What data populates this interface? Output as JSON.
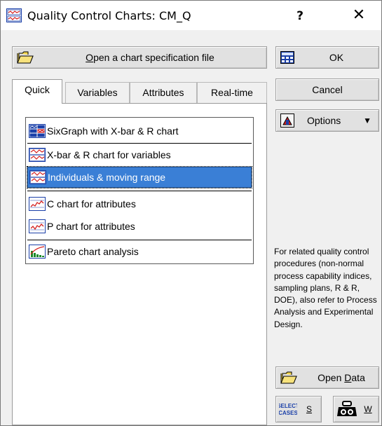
{
  "window": {
    "title": "Quality Control Charts: CM_Q",
    "help_glyph": "?",
    "close_glyph": "✕"
  },
  "buttons": {
    "open_spec": {
      "prefix": "",
      "accel": "O",
      "rest": "pen a chart specification file",
      "icon": "open-folder-icon"
    },
    "ok": {
      "label": "OK",
      "icon": "ok-calculator-icon"
    },
    "cancel": {
      "label": "Cancel"
    },
    "options": {
      "label": "Options",
      "arrow": "▼",
      "icon": "options-icon"
    },
    "open_data": {
      "prefix": "Open ",
      "accel": "D",
      "rest": "ata",
      "icon": "open-folder-icon"
    },
    "select_cases": {
      "icon_text_top": "SELECT",
      "icon_text_bottom": "CASES",
      "accel": "S"
    },
    "weight": {
      "accel": "W",
      "icon": "weight-icon"
    }
  },
  "tabs": [
    {
      "label": "Quick",
      "active": true
    },
    {
      "label": "Variables",
      "active": false
    },
    {
      "label": "Attributes",
      "active": false
    },
    {
      "label": "Real-time",
      "active": false
    }
  ],
  "chart_list": [
    {
      "label": "SixGraph with X-bar & R chart",
      "icon": "sixgraph-icon",
      "selected": false
    },
    {
      "label": "X-bar & R chart for variables",
      "icon": "xbar-r-chart-icon",
      "selected": false
    },
    {
      "label": "Individuals & moving range",
      "icon": "individuals-chart-icon",
      "selected": true
    },
    {
      "label": "C chart for attributes",
      "icon": "c-chart-icon",
      "selected": false
    },
    {
      "label": "P chart for attributes",
      "icon": "p-chart-icon",
      "selected": false
    },
    {
      "label": "Pareto chart analysis",
      "icon": "pareto-chart-icon",
      "selected": false
    }
  ],
  "note": "For related quality control procedures (non-normal process capability indices, sampling plans, R & R, DOE), also refer to Process Analysis and Experimental Design.",
  "colors": {
    "selection": "#3a7fd6",
    "chart_red": "#d42020",
    "chart_blue": "#1a3fa8",
    "folder_yellow": "#f2d44b"
  }
}
